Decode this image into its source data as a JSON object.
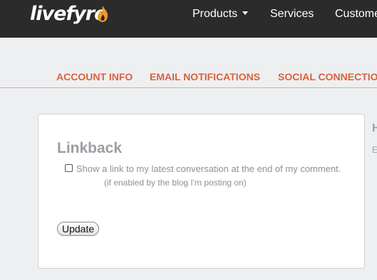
{
  "header": {
    "logo": "livefyre",
    "nav": {
      "products": "Products",
      "services": "Services",
      "customers": "Custome"
    }
  },
  "tabs": {
    "account_info": "ACCOUNT INFO",
    "email_notifications": "EMAIL NOTIFICATIONS",
    "social_connections": "SOCIAL CONNECTIO"
  },
  "linkback": {
    "title": "Linkback",
    "option_label": "Show a link to my latest conversation at the end of my comment.",
    "option_note": "(if enabled by the blog I'm posting on)",
    "option_checked": false,
    "update_label": "Update"
  },
  "side_panel": {
    "heading": "H",
    "text": "E"
  },
  "colors": {
    "topbar": "#2b2b2b",
    "accent": "#d8623d",
    "flame": "#f29a2e",
    "muted_text": "#9b9ea3"
  },
  "icons": {
    "logo_flame": "flame-icon",
    "products_caret": "caret-down-icon"
  }
}
